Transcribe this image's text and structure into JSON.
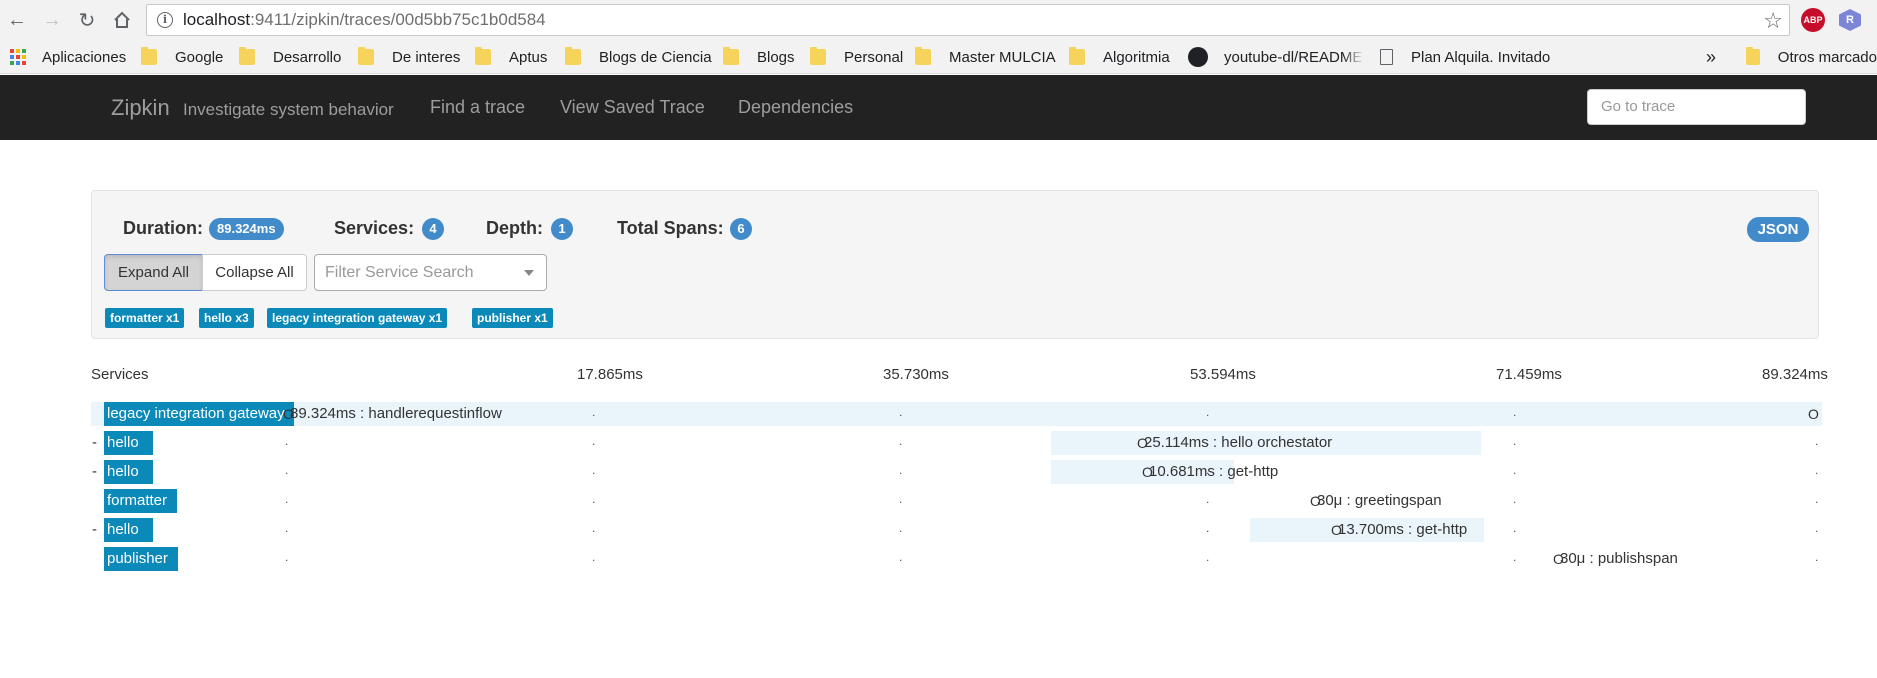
{
  "browser": {
    "url_host": "localhost",
    "url_rest": ":9411/zipkin/traces/00d5bb75c1b0d584",
    "ext_abp": "ABP",
    "ext_r": "R",
    "bookmarks": [
      "Aplicaciones",
      "Google",
      "Desarrollo",
      "De interes",
      "Aptus",
      "Blogs de Ciencia",
      "Blogs",
      "Personal",
      "Master MULCIA",
      "Algoritmia",
      "youtube-dl/README",
      "Plan Alquila. Invitado"
    ],
    "overflow": "»",
    "other_bookmarks": "Otros marcado"
  },
  "navbar": {
    "brand": "Zipkin",
    "tagline": "Investigate system behavior",
    "links": [
      "Find a trace",
      "View Saved Trace",
      "Dependencies"
    ],
    "goto_placeholder": "Go to trace"
  },
  "summary": {
    "duration_label": "Duration:",
    "duration_value": "89.324ms",
    "services_label": "Services:",
    "services_value": "4",
    "depth_label": "Depth:",
    "depth_value": "1",
    "total_spans_label": "Total Spans:",
    "total_spans_value": "6",
    "json_button": "JSON",
    "expand_all": "Expand All",
    "collapse_all": "Collapse All",
    "filter_placeholder": "Filter Service Search",
    "service_tags": [
      "formatter x1",
      "hello x3",
      "legacy integration gateway x1",
      "publisher x1"
    ]
  },
  "timeline": {
    "services_header": "Services",
    "ticks": [
      "17.865ms",
      "35.730ms",
      "53.594ms",
      "71.459ms",
      "89.324ms"
    ],
    "spans": [
      {
        "service": "legacy integration gateway",
        "expander": "",
        "text": "89.324ms : handlerequestinflow",
        "start_fraction": 0.0,
        "duration_fraction": 1.0
      },
      {
        "service": "hello",
        "expander": "-",
        "text": "25.114ms : hello orchestator",
        "start_fraction": 0.5,
        "duration_fraction": 0.281
      },
      {
        "service": "hello",
        "expander": "-",
        "text": "10.681ms : get-http",
        "start_fraction": 0.5,
        "duration_fraction": 0.12
      },
      {
        "service": "formatter",
        "expander": "",
        "text": "30μ : greetingspan",
        "start_fraction": 0.62,
        "duration_fraction": 0.0
      },
      {
        "service": "hello",
        "expander": "-",
        "text": "13.700ms : get-http",
        "start_fraction": 0.63,
        "duration_fraction": 0.153
      },
      {
        "service": "publisher",
        "expander": "",
        "text": "30μ : publishspan",
        "start_fraction": 0.781,
        "duration_fraction": 0.0
      }
    ]
  }
}
